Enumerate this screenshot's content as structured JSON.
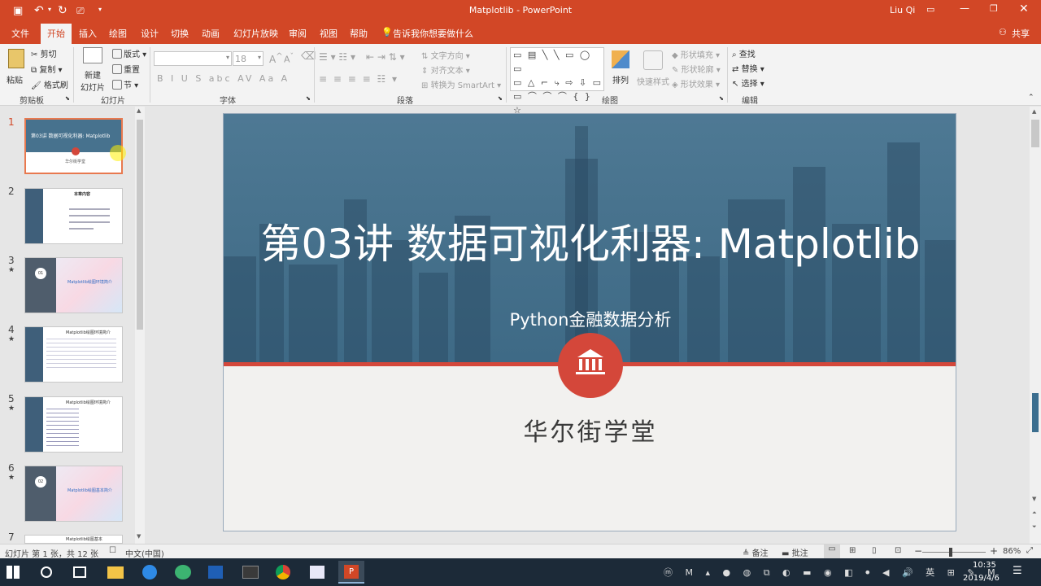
{
  "window": {
    "title": "Matplotlib - PowerPoint",
    "user": "Liu Qi"
  },
  "ribbon_tabs": [
    "文件",
    "开始",
    "插入",
    "绘图",
    "设计",
    "切换",
    "动画",
    "幻灯片放映",
    "审阅",
    "视图",
    "帮助"
  ],
  "tell_me": "告诉我你想要做什么",
  "share": "共享",
  "groups": {
    "clipboard": {
      "label": "剪贴板",
      "paste": "粘贴",
      "cut": "剪切",
      "copy": "复制",
      "format_painter": "格式刷"
    },
    "slides": {
      "label": "幻灯片",
      "new_slide_1": "新建",
      "new_slide_2": "幻灯片",
      "layout": "版式",
      "reset": "重置",
      "section": "节"
    },
    "font": {
      "label": "字体",
      "font_name": "",
      "font_size": "18",
      "buttons": "B I U S abc AV Aa A"
    },
    "paragraph": {
      "label": "段落",
      "text_direction": "文字方向",
      "align_text": "对齐文本",
      "smartart": "转换为 SmartArt"
    },
    "drawing": {
      "label": "绘图",
      "arrange": "排列",
      "quick_styles": "快速样式",
      "shape_fill": "形状填充",
      "shape_outline": "形状轮廓",
      "shape_effects": "形状效果"
    },
    "editing": {
      "label": "编辑",
      "find": "查找",
      "replace": "替换",
      "select": "选择"
    }
  },
  "thumbnails": [
    {
      "num": "1",
      "star": "",
      "title": "第03讲 数据可视化利器: Matplotlib",
      "sub": "华尔街学堂"
    },
    {
      "num": "2",
      "star": "",
      "title": "本章内容",
      "sub": ""
    },
    {
      "num": "3",
      "star": "★",
      "title": "Matplotlib绘图环境简介",
      "sub": "01"
    },
    {
      "num": "4",
      "star": "★",
      "title": "Matplotlib绘图环境简介",
      "sub": ""
    },
    {
      "num": "5",
      "star": "★",
      "title": "Matplotlib绘图环境简介",
      "sub": ""
    },
    {
      "num": "6",
      "star": "★",
      "title": "Matplotlib绘图基本简介",
      "sub": "02"
    },
    {
      "num": "7",
      "star": "",
      "title": "Matplotlib绘图基本",
      "sub": ""
    }
  ],
  "slide": {
    "title": "第03讲  数据可视化利器: Matplotlib",
    "subtitle": "Python金融数据分析",
    "brand": "华尔街学堂"
  },
  "status": {
    "slide_info": "幻灯片 第 1 张，共 12 张",
    "language": "中文(中国)",
    "notes": "备注",
    "comments": "批注",
    "zoom": "86%"
  },
  "clock": {
    "time": "10:35",
    "date": "2019/4/6"
  },
  "colors": {
    "accent": "#d24726",
    "slide_band": "#4e7994",
    "slide_red": "#d4473a"
  }
}
